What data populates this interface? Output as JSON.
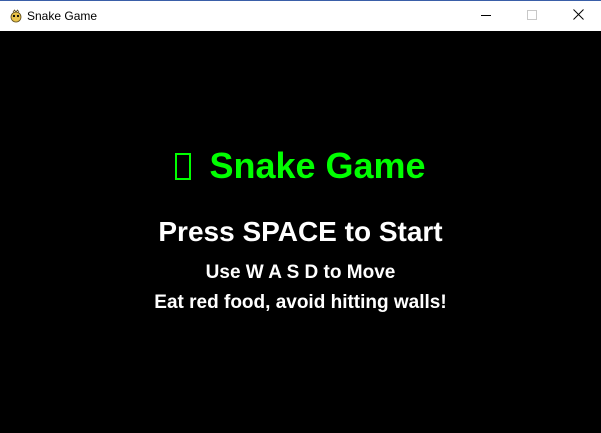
{
  "window": {
    "title": "Snake Game",
    "icon": "pygame-snake-icon"
  },
  "title_controls": {
    "minimize_icon": "minimize-icon",
    "maximize_icon": "maximize-icon",
    "close_icon": "close-icon"
  },
  "game": {
    "title": "Snake Game",
    "title_glyph": "missing-glyph-box",
    "prompt": "Press SPACE to Start",
    "instructions": "Use W A S D to Move",
    "goal": "Eat red food, avoid hitting walls!"
  },
  "colors": {
    "background": "#000000",
    "title_color": "#00ff00",
    "text_color": "#ffffff",
    "titlebar_bg": "#ffffff"
  }
}
